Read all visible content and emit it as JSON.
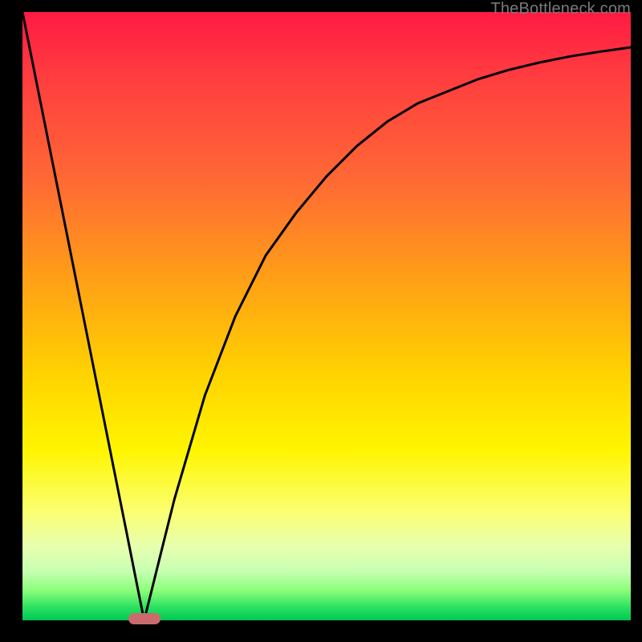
{
  "watermark": "TheBottleneck.com",
  "colors": {
    "frame": "#000000",
    "gradient_top": "#ff1a44",
    "gradient_mid": "#ffd400",
    "gradient_bottom": "#00c853",
    "curve": "#000000",
    "marker": "#cc6b6e",
    "watermark_text": "#7a7a7a"
  },
  "chart_data": {
    "type": "line",
    "title": "",
    "xlabel": "",
    "ylabel": "",
    "xlim": [
      0,
      100
    ],
    "ylim": [
      0,
      100
    ],
    "grid": false,
    "legend": false,
    "series": [
      {
        "name": "bottleneck-curve",
        "x": [
          0,
          5,
          10,
          15,
          17,
          19,
          20,
          21,
          23,
          25,
          30,
          35,
          40,
          45,
          50,
          55,
          60,
          65,
          70,
          75,
          80,
          85,
          90,
          95,
          100
        ],
        "values": [
          100,
          75,
          50,
          25,
          15,
          5,
          0,
          4,
          12,
          20,
          37,
          50,
          60,
          67,
          73,
          78,
          82,
          85,
          87,
          89,
          90.5,
          91.7,
          92.7,
          93.5,
          94.2
        ]
      }
    ],
    "annotations": [
      {
        "name": "optimal-marker",
        "x": 20,
        "y": 0,
        "shape": "pill",
        "color": "#cc6b6e"
      }
    ]
  }
}
